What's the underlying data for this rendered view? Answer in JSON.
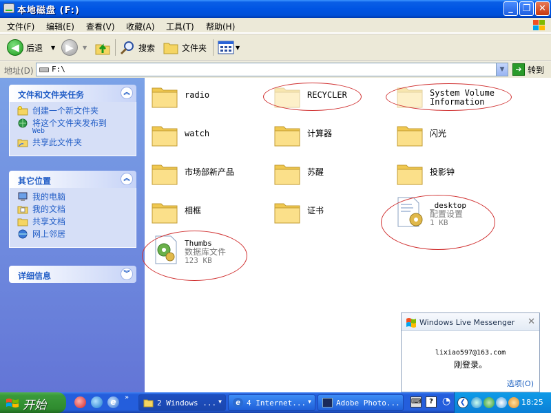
{
  "window": {
    "title": "本地磁盘 (F:)",
    "btn_min": "_",
    "btn_max": "❐",
    "btn_close": "✕"
  },
  "menu": {
    "items": [
      "文件(F)",
      "编辑(E)",
      "查看(V)",
      "收藏(A)",
      "工具(T)",
      "帮助(H)"
    ]
  },
  "toolbar": {
    "back_label": "后退",
    "search_label": "搜索",
    "folders_label": "文件夹"
  },
  "address": {
    "label": "地址(D)",
    "value": "F:\\",
    "go_label": "转到"
  },
  "left_pane": {
    "tasks": {
      "title": "文件和文件夹任务",
      "items": [
        {
          "label": "创建一个新文件夹",
          "icon": "new-folder-icon"
        },
        {
          "label": "将这个文件夹发布到",
          "sub": "Web",
          "icon": "publish-web-icon"
        },
        {
          "label": "共享此文件夹",
          "icon": "share-folder-icon"
        }
      ]
    },
    "places": {
      "title": "其它位置",
      "items": [
        {
          "label": "我的电脑",
          "icon": "my-computer-icon"
        },
        {
          "label": "我的文档",
          "icon": "my-documents-icon"
        },
        {
          "label": "共享文档",
          "icon": "shared-documents-icon"
        },
        {
          "label": "网上邻居",
          "icon": "network-places-icon"
        }
      ]
    },
    "details": {
      "title": "详细信息"
    }
  },
  "files": [
    {
      "name": "radio",
      "type": "folder"
    },
    {
      "name": "RECYCLER",
      "type": "folder-hidden"
    },
    {
      "name": "System Volume Information",
      "type": "folder-hidden"
    },
    {
      "name": "watch",
      "type": "folder"
    },
    {
      "name": "计算器",
      "type": "folder"
    },
    {
      "name": "闪光",
      "type": "folder"
    },
    {
      "name": "市场部新产品",
      "type": "folder"
    },
    {
      "name": "苏醒",
      "type": "folder"
    },
    {
      "name": "投影钟",
      "type": "folder"
    },
    {
      "name": "相框",
      "type": "folder"
    },
    {
      "name": "证书",
      "type": "folder"
    },
    {
      "name": "_desktop",
      "kind": "配置设置",
      "size": "1 KB",
      "type": "config-file"
    },
    {
      "name": "Thumbs",
      "kind": "数据库文件",
      "size": "123 KB",
      "type": "database-file"
    }
  ],
  "messenger": {
    "title": "Windows Live Messenger",
    "email": "lixiao597@163.com",
    "status": "刚登录。",
    "options": "选项(O)",
    "close": "✕"
  },
  "taskbar": {
    "start_label": "开始",
    "buttons": [
      {
        "label": "2 Windows ...",
        "icon": "folder-icon"
      },
      {
        "label": "4 Internet...",
        "icon": "ie-icon"
      },
      {
        "label": "Adobe Photo...",
        "icon": "photoshop-icon"
      }
    ],
    "clock": "18:25"
  },
  "colors": {
    "title_blue": "#0054e3",
    "pane_blue": "#6375d6",
    "link_blue": "#215dc6",
    "highlight_red": "#d03030",
    "start_green": "#3a9a3a"
  }
}
